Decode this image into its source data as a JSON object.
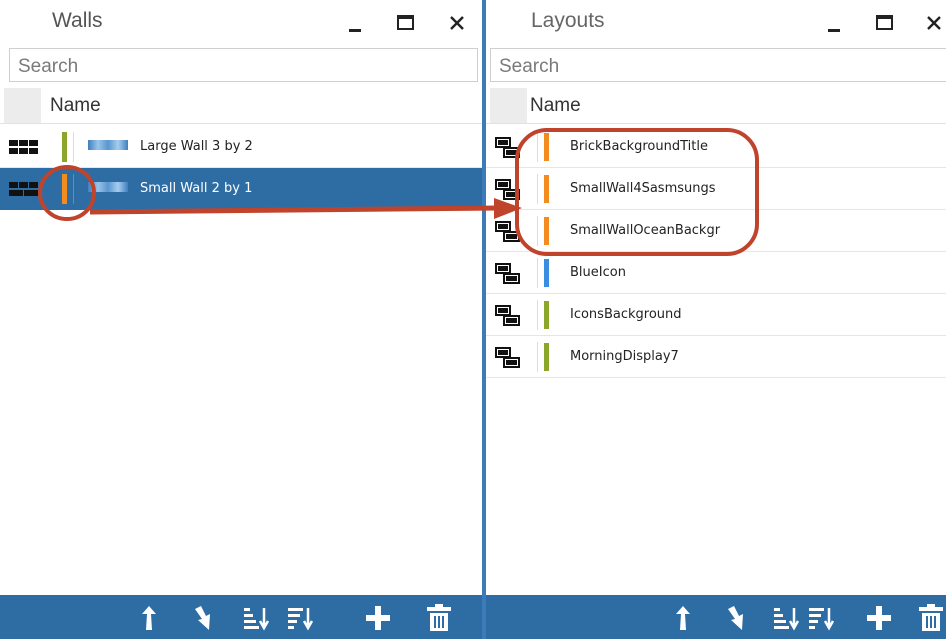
{
  "walls": {
    "title": "Walls",
    "search_placeholder": "Search",
    "column_name": "Name",
    "rows": [
      {
        "label": "Large Wall 3 by 2",
        "color": "#8ca52b"
      },
      {
        "label": "Small Wall 2 by 1",
        "color": "#f28c1e"
      }
    ],
    "selected_row": "Small Wall 2 by 1"
  },
  "layouts": {
    "title": "Layouts",
    "search_placeholder": "Search",
    "column_name": "Name",
    "rows": [
      {
        "label": "BrickBackgroundTitle",
        "color": "#f28c1e"
      },
      {
        "label": "SmallWall4Sasmsungs",
        "color": "#f28c1e"
      },
      {
        "label": "SmallWallOceanBackgr",
        "color": "#f28c1e"
      },
      {
        "label": "BlueIcon",
        "color": "#3a8ee0"
      },
      {
        "label": "IconsBackground",
        "color": "#8ca52b"
      },
      {
        "label": "MorningDisplay7",
        "color": "#8ca52b"
      }
    ]
  },
  "icons": {
    "window_buttons": [
      "minimize-icon",
      "maximize-icon",
      "close-icon"
    ],
    "toolbar": [
      "move-up-icon",
      "move-down-icon",
      "sort-ascending-icon",
      "sort-descending-icon",
      "add-icon",
      "delete-icon"
    ]
  },
  "colors": {
    "accent": "#2e6da4",
    "selection": "#2e6da4",
    "annotation": "#c0432c"
  }
}
